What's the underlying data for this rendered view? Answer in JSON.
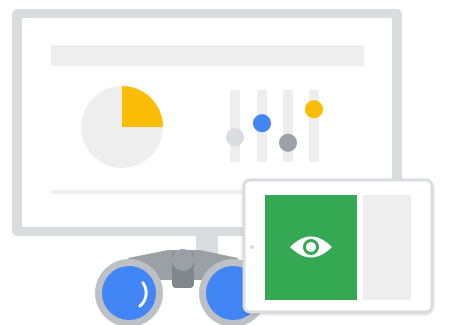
{
  "colors": {
    "monitor_frame": "#dadce0",
    "monitor_screen": "#ffffff",
    "placeholder_bar": "#eeeeef",
    "pie_base": "#eeeeef",
    "pie_slice": "#fbbc04",
    "slider_track": "#eeeeef",
    "slider_blue": "#4285f4",
    "slider_gray_light": "#dadce0",
    "slider_gray_dark": "#9aa0a6",
    "slider_yellow": "#fbbc04",
    "tablet_body": "#ffffff",
    "tablet_panel": "#34a853",
    "tablet_side": "#eeeeef",
    "binocular_body": "#9aa0a6",
    "binocular_lens": "#4285f4",
    "binocular_rim": "#bdc1c6"
  },
  "icons": {
    "panel_icon": "eye-icon",
    "device": "binoculars-icon"
  },
  "pie_chart": {
    "highlighted_fraction": 0.25
  },
  "sliders": [
    {
      "color": "gray-light",
      "level": 0.3
    },
    {
      "color": "blue",
      "level": 0.55
    },
    {
      "color": "gray-dark",
      "level": 0.2
    },
    {
      "color": "yellow",
      "level": 0.8
    }
  ]
}
